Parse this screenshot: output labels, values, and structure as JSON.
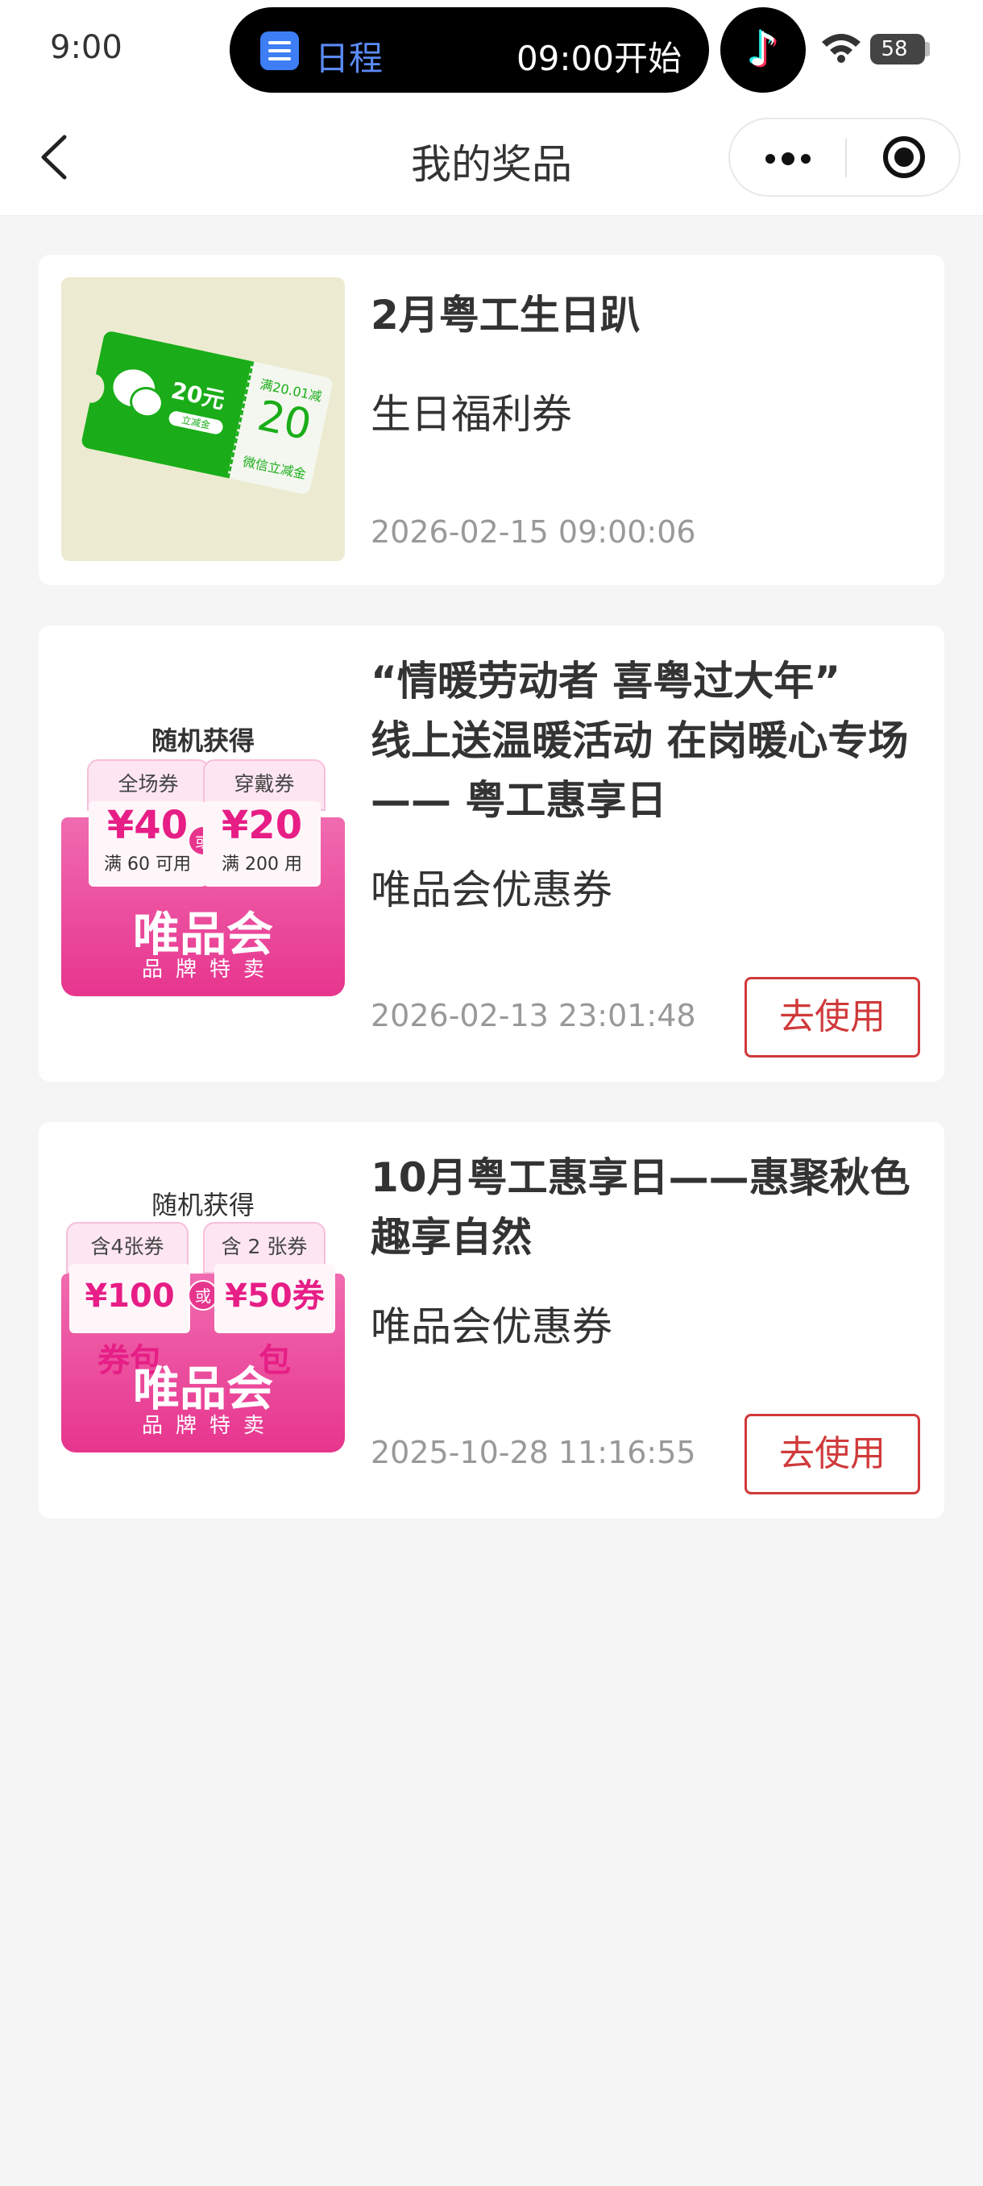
{
  "status_bar": {
    "time": "9:00",
    "island_label": "日程",
    "island_time": "09:00开始",
    "battery": "58"
  },
  "nav": {
    "title": "我的奖品"
  },
  "prizes": [
    {
      "title": "2月粤工生日趴",
      "type": "生日福利券",
      "date": "2026-02-15 09:00:06",
      "image": {
        "amount": "20元",
        "pill": "立减金",
        "condition": "满20.01减",
        "value": "20",
        "caption": "微信立减金"
      }
    },
    {
      "title_lines": [
        "“情暖劳动者 喜粤过大年”",
        "线上送温暖活动 在岗暖心专场",
        "—— 粤工惠享日"
      ],
      "type": "唯品会优惠券",
      "date": "2026-02-13 23:01:48",
      "button": "去使用",
      "image": {
        "heading": "随机获得",
        "tab_left": "全场券",
        "tab_right": "穿戴券",
        "left_value": "¥40",
        "left_note": "满 60 可用",
        "or": "或",
        "right_value": "¥20",
        "right_note": "满 200 用",
        "brand": "唯品会",
        "brand_sub": "品牌特卖"
      }
    },
    {
      "title_lines": [
        "10月粤工惠享日——惠聚秋色",
        "趣享自然"
      ],
      "type": "唯品会优惠券",
      "date": "2025-10-28 11:16:55",
      "button": "去使用",
      "image": {
        "heading": "随机获得",
        "tab_left": "含4张券",
        "tab_right": "含 2 张券",
        "left_value": "¥100券包",
        "or": "或",
        "right_value": "¥50券包",
        "brand": "唯品会",
        "brand_sub": "品牌特卖"
      }
    }
  ]
}
